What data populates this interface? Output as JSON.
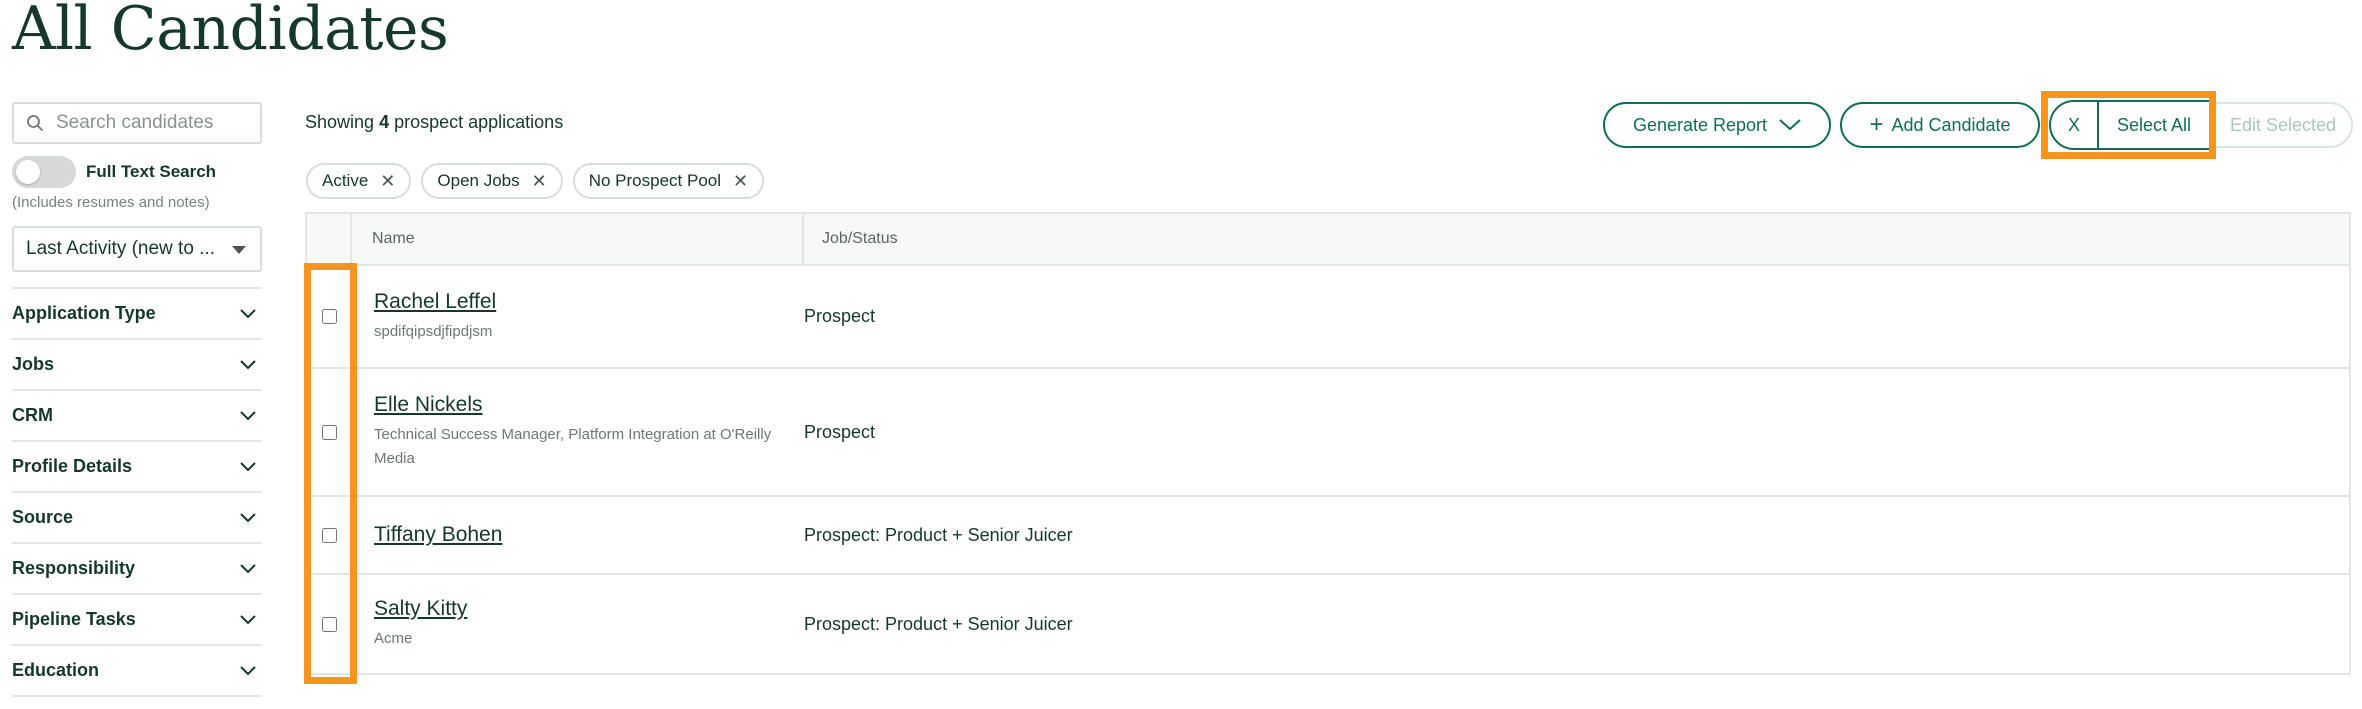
{
  "page": {
    "title": "All Candidates"
  },
  "sidebar": {
    "search_placeholder": "Search candidates",
    "full_text_search_label": "Full Text Search",
    "full_text_search_note": "(Includes resumes and notes)",
    "sort_value": "Last Activity (new to ...",
    "filters": [
      {
        "label": "Application Type"
      },
      {
        "label": "Jobs"
      },
      {
        "label": "CRM"
      },
      {
        "label": "Profile Details"
      },
      {
        "label": "Source"
      },
      {
        "label": "Responsibility"
      },
      {
        "label": "Pipeline Tasks"
      },
      {
        "label": "Education"
      }
    ]
  },
  "summary": {
    "prefix": "Showing",
    "count": "4",
    "suffix": "prospect applications"
  },
  "toolbar": {
    "generate_report": "Generate Report",
    "add_candidate": "Add Candidate",
    "clear": "X",
    "select_all": "Select All",
    "edit_selected": "Edit Selected"
  },
  "chips": [
    {
      "label": "Active"
    },
    {
      "label": "Open Jobs"
    },
    {
      "label": "No Prospect Pool"
    }
  ],
  "table": {
    "headers": {
      "name": "Name",
      "job_status": "Job/Status"
    },
    "rows": [
      {
        "name": "Rachel Leffel",
        "subtitle": "spdifqipsdjfipdjsm",
        "status": "Prospect"
      },
      {
        "name": "Elle Nickels",
        "subtitle": "Technical Success Manager, Platform Integration at O'Reilly Media",
        "status": "Prospect"
      },
      {
        "name": "Tiffany Bohen",
        "subtitle": "",
        "status": "Prospect: Product + Senior Juicer"
      },
      {
        "name": "Salty Kitty",
        "subtitle": "Acme",
        "status": "Prospect: Product + Senior Juicer"
      }
    ]
  },
  "colors": {
    "accent": "#0f6e55",
    "highlight": "#f7941d",
    "text": "#15372c"
  },
  "icons": {
    "search": "search-icon",
    "chevron": "chevron-down-icon",
    "remove": "close-icon",
    "plus": "plus-icon"
  }
}
